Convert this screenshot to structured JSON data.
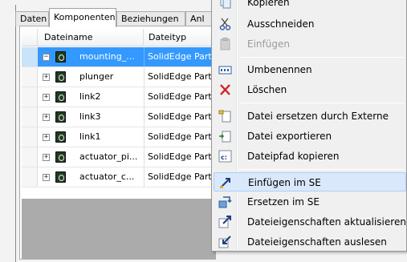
{
  "tabs": [
    {
      "label": "Daten"
    },
    {
      "label": "Komponenten"
    },
    {
      "label": "Beziehungen"
    },
    {
      "label": "Anl"
    }
  ],
  "grid": {
    "columns": [
      {
        "label": "Dateiname"
      },
      {
        "label": "Dateityp"
      }
    ],
    "rows": [
      {
        "name": "mounting_...",
        "type": "SolidEdge Part",
        "expander": "⊟",
        "selected": true
      },
      {
        "name": "plunger",
        "type": "SolidEdge Part",
        "expander": "⊞"
      },
      {
        "name": "link2",
        "type": "SolidEdge Part",
        "expander": "⊞"
      },
      {
        "name": "link3",
        "type": "SolidEdge Part",
        "expander": "⊞"
      },
      {
        "name": "link1",
        "type": "SolidEdge Part",
        "expander": "⊞"
      },
      {
        "name": "actuator_pi...",
        "type": "SolidEdge Part",
        "expander": "⊞"
      },
      {
        "name": "actuator_c...",
        "type": "SolidEdge Part",
        "expander": "⊞"
      }
    ]
  },
  "context_menu": {
    "items": [
      {
        "label": "Kopieren",
        "icon": "copy-icon",
        "glyph": "⎘",
        "color": "#5b7fa8"
      },
      {
        "label": "Ausschneiden",
        "icon": "scissors-icon",
        "glyph": "✂",
        "color": "#333333"
      },
      {
        "label": "Einfügen",
        "icon": "paste-icon",
        "glyph": "📋",
        "color": "#b0b0b0",
        "disabled": true
      },
      {
        "label": "Umbenennen",
        "icon": "rename-icon",
        "glyph": "▭",
        "color": "#1f5fa8"
      },
      {
        "label": "Löschen",
        "icon": "delete-icon",
        "glyph": "✕",
        "color": "#d02020"
      },
      {
        "label": "Datei ersetzen durch Externe",
        "icon": "replace-file-icon",
        "glyph": "🗎",
        "color": "#4a6a8a"
      },
      {
        "label": "Datei exportieren",
        "icon": "export-file-icon",
        "glyph": "🗎",
        "color": "#3a6a3a"
      },
      {
        "label": "Dateipfad kopieren",
        "icon": "copy-path-icon",
        "glyph": "c:",
        "color": "#1f3f7f"
      },
      {
        "label": "Einfügen im SE",
        "icon": "insert-se-icon",
        "glyph": "↗",
        "color": "#1f3f7f",
        "highlight": true
      },
      {
        "label": "Ersetzen im SE",
        "icon": "replace-se-icon",
        "glyph": "⇄",
        "color": "#2f6fbf"
      },
      {
        "label": "Dateieigenschaften aktualisieren",
        "icon": "update-props-icon",
        "glyph": "↗",
        "color": "#1f3f7f"
      },
      {
        "label": "Dateieigenschaften auslesen",
        "icon": "read-props-icon",
        "glyph": "↗",
        "color": "#1f3f7f"
      }
    ]
  },
  "colors": {
    "selection": "#3399ff",
    "menu_highlight": "#d9e8fb",
    "grid_empty": "#ababab"
  }
}
